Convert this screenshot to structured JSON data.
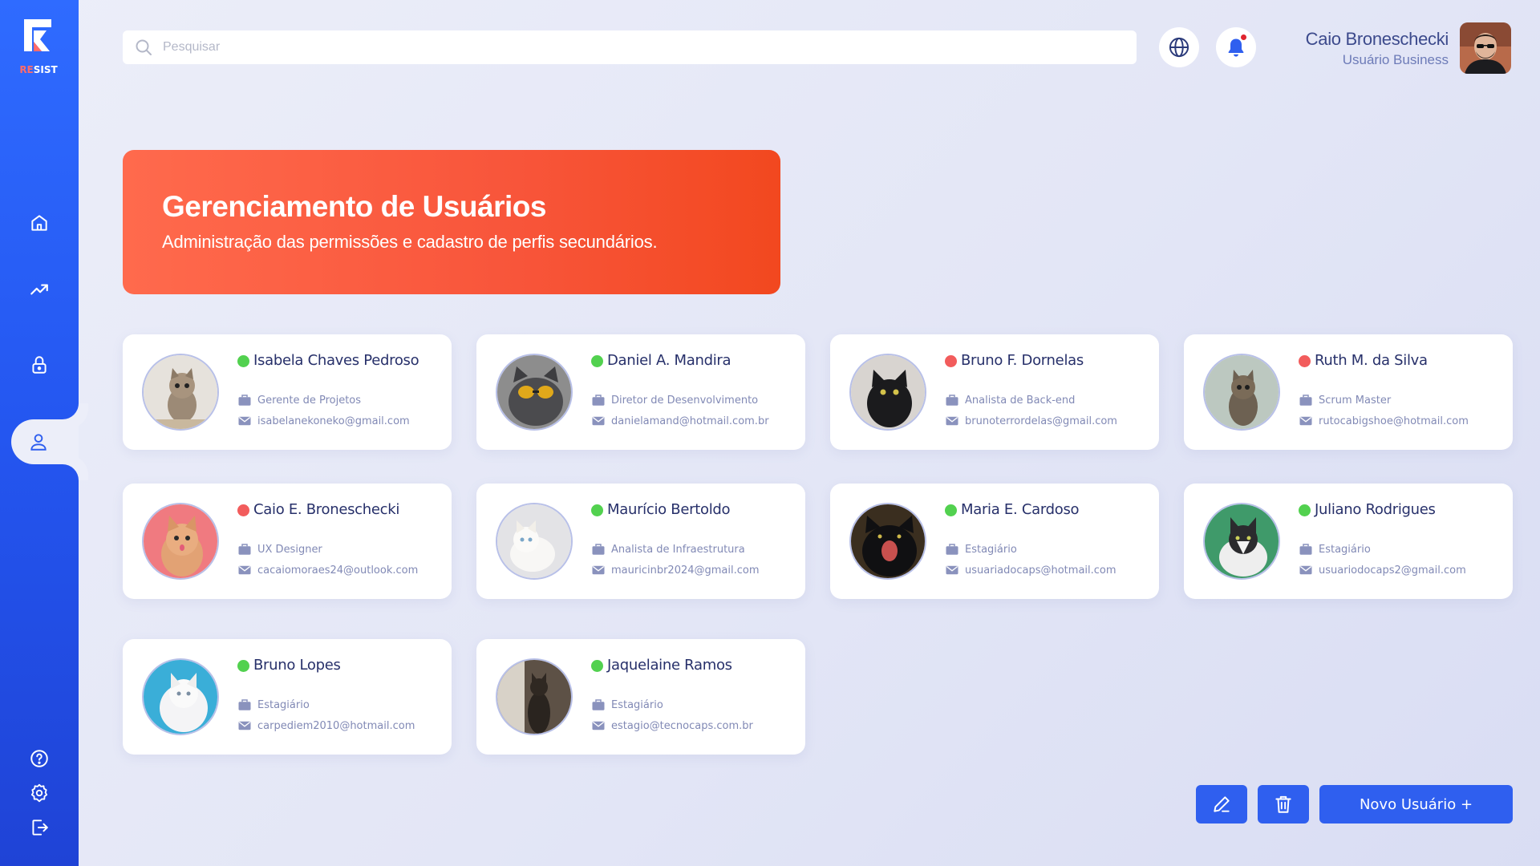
{
  "app": {
    "logo_text_red": "RE",
    "logo_text_white": "SIST"
  },
  "search": {
    "placeholder": "Pesquisar"
  },
  "user": {
    "name": "Caio Broneschecki",
    "role": "Usuário Business"
  },
  "banner": {
    "title": "Gerenciamento de Usuários",
    "subtitle": "Administração das permissões e cadastro de perfis secundários."
  },
  "users": [
    {
      "name": "Isabela Chaves Pedroso",
      "role": "Gerente de Projetos",
      "email": "isabelanekoneko@gmail.com",
      "status": "online"
    },
    {
      "name": "Daniel A. Mandira",
      "role": "Diretor de Desenvolvimento",
      "email": "danielamand@hotmail.com.br",
      "status": "online"
    },
    {
      "name": "Bruno F. Dornelas",
      "role": "Analista de Back-end",
      "email": "brunoterrordelas@gmail.com",
      "status": "offline"
    },
    {
      "name": "Ruth M. da Silva",
      "role": "Scrum Master",
      "email": "rutocabigshoe@hotmail.com",
      "status": "offline"
    },
    {
      "name": "Caio E. Broneschecki",
      "role": "UX Designer",
      "email": "cacaiomoraes24@outlook.com",
      "status": "offline"
    },
    {
      "name": "Maurício Bertoldo",
      "role": "Analista de Infraestrutura",
      "email": "mauricinbr2024@gmail.com",
      "status": "online"
    },
    {
      "name": "Maria E. Cardoso",
      "role": "Estagiário",
      "email": "usuariadocaps@hotmail.com",
      "status": "online"
    },
    {
      "name": "Juliano Rodrigues",
      "role": "Estagiário",
      "email": "usuariodocaps2@gmail.com",
      "status": "online"
    },
    {
      "name": "Bruno Lopes",
      "role": "Estagiário",
      "email": "carpediem2010@hotmail.com",
      "status": "online"
    },
    {
      "name": "Jaquelaine Ramos",
      "role": "Estagiário",
      "email": "estagio@tecnocaps.com.br",
      "status": "online"
    }
  ],
  "actions": {
    "new_user_label": "Novo Usuário +"
  },
  "colors": {
    "accent": "#2f5fef",
    "banner": "#f8553a",
    "status_online": "#52d14f",
    "status_offline": "#f25c5c"
  },
  "icons": {
    "sidebar": [
      "home-icon",
      "trending-icon",
      "lock-icon",
      "user-icon",
      "help-icon",
      "settings-icon",
      "logout-icon"
    ],
    "header": [
      "search-icon",
      "globe-icon",
      "bell-icon"
    ],
    "card": [
      "briefcase-icon",
      "mail-icon"
    ],
    "buttons": [
      "edit-icon",
      "trash-icon"
    ]
  }
}
